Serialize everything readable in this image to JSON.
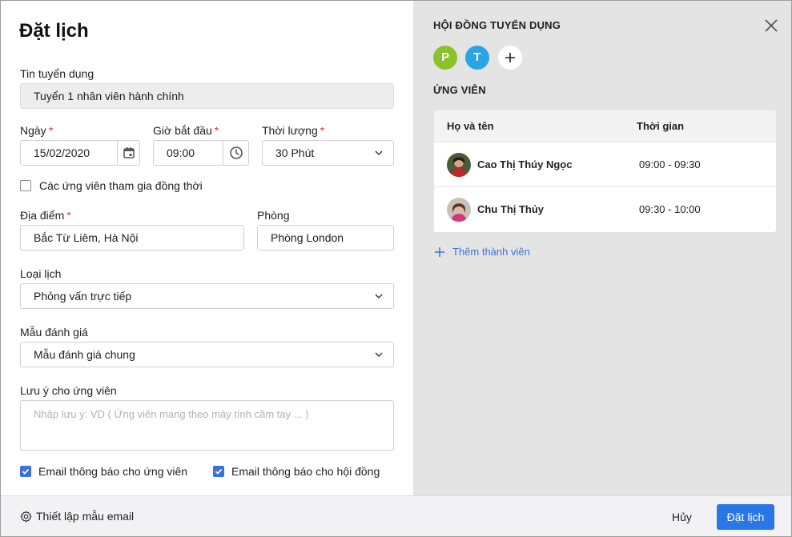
{
  "form": {
    "title": "Đặt lịch",
    "job_post": {
      "label": "Tin tuyển dụng",
      "value": "Tuyển 1 nhân viên hành chính"
    },
    "date": {
      "label": "Ngày",
      "value": "15/02/2020",
      "required": "*"
    },
    "start_time": {
      "label": "Giờ bắt đầu",
      "value": "09:00",
      "required": "*"
    },
    "duration": {
      "label": "Thời lượng",
      "value": "30 Phút",
      "required": "*"
    },
    "simultaneous": {
      "label": "Các ứng viên tham gia đồng thời",
      "checked": false
    },
    "location": {
      "label": "Địa điểm",
      "value": "Bắc Từ Liêm, Hà Nội",
      "required": "*"
    },
    "room": {
      "label": "Phòng",
      "value": "Phòng London"
    },
    "schedule_type": {
      "label": "Loại lịch",
      "value": "Phỏng vấn trực tiếp"
    },
    "eval_template": {
      "label": "Mẫu đánh giá",
      "value": "Mẫu đánh giá chung"
    },
    "note": {
      "label": "Lưu ý cho ứng viên",
      "placeholder": "Nhập lưu ý: VD ( Ứng viên mang theo máy tính cầm tay ... )"
    },
    "email_candidate": {
      "label": "Email thông báo cho ứng viên",
      "checked": true
    },
    "email_council": {
      "label": "Email thông báo cho hội đồng",
      "checked": true
    }
  },
  "panel": {
    "council_title": "HỘI ĐỒNG TUYỂN DỤNG",
    "council_members": [
      {
        "initial": "P",
        "color": "#8bc12b"
      },
      {
        "initial": "T",
        "color": "#2ba4e3"
      }
    ],
    "candidates_title": "ỨNG VIÊN",
    "table": {
      "headers": {
        "name": "Họ và tên",
        "time": "Thời gian"
      },
      "rows": [
        {
          "name": "Cao Thị Thúy Ngọc",
          "time": "09:00 - 09:30"
        },
        {
          "name": "Chu Thị Thủy",
          "time": "09:30 - 10:00"
        }
      ]
    },
    "add_member": "Thêm thành viên"
  },
  "footer": {
    "settings": "Thiết lập mẫu email",
    "cancel": "Hủy",
    "submit": "Đặt lịch"
  },
  "colors": {
    "accent": "#2b76e5",
    "required": "#e53935",
    "panel_bg": "#e4e4e4"
  }
}
